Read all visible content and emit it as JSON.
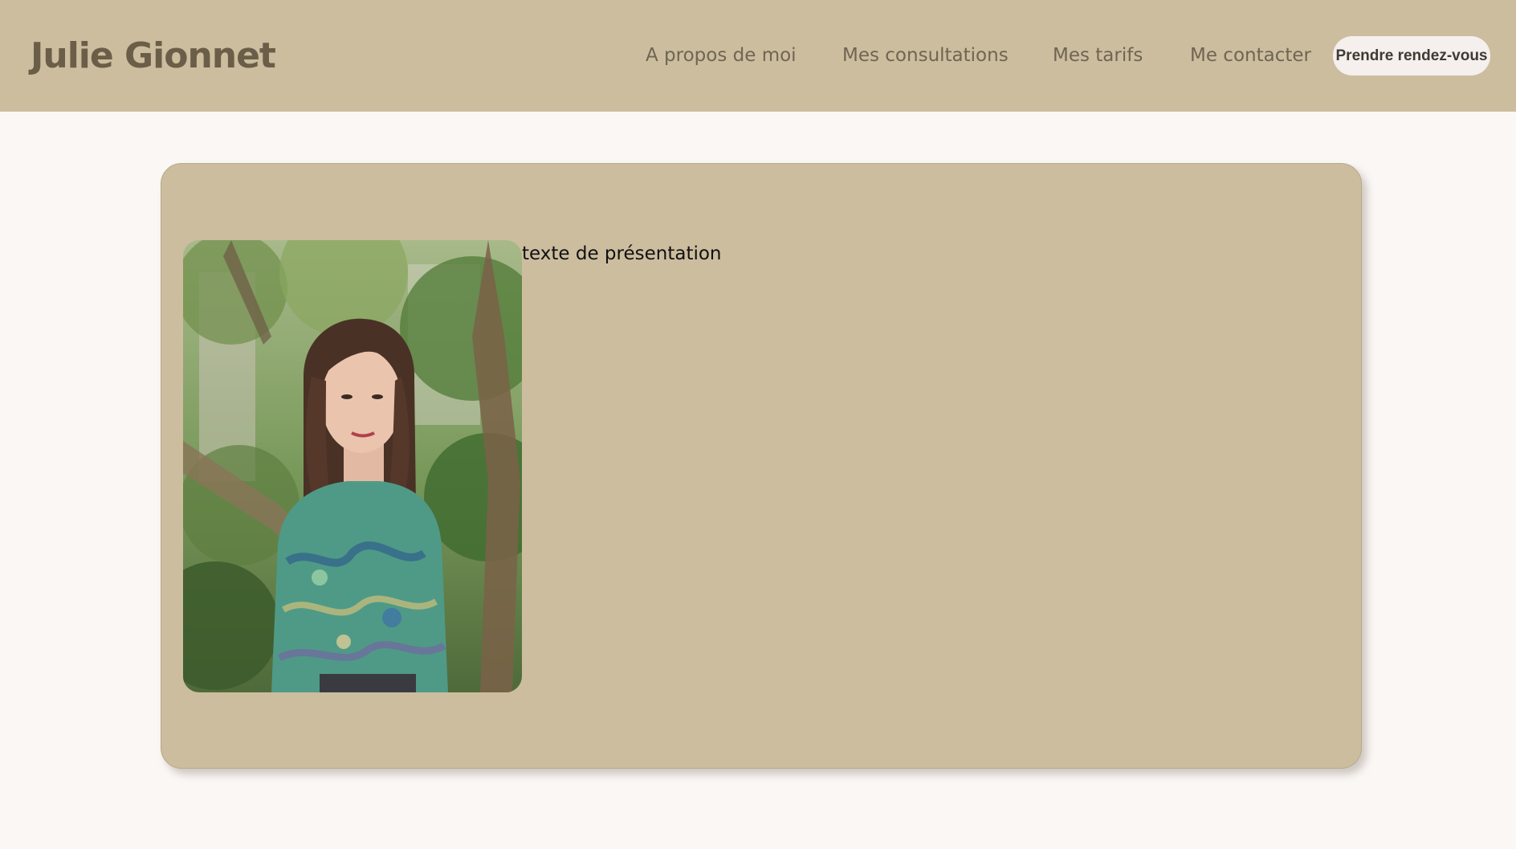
{
  "header": {
    "brand": "Julie Gionnet",
    "nav": [
      {
        "label": "A propos de moi"
      },
      {
        "label": "Mes consultations"
      },
      {
        "label": "Mes tarifs"
      },
      {
        "label": "Me contacter"
      }
    ],
    "cta_label": "Prendre rendez-vous"
  },
  "main": {
    "intro_text": "texte de présentation"
  },
  "colors": {
    "header_bg": "#ccbd9f",
    "page_bg": "#fbf7f5",
    "brand_text": "#6b5e48",
    "cta_bg": "#f5efed"
  }
}
